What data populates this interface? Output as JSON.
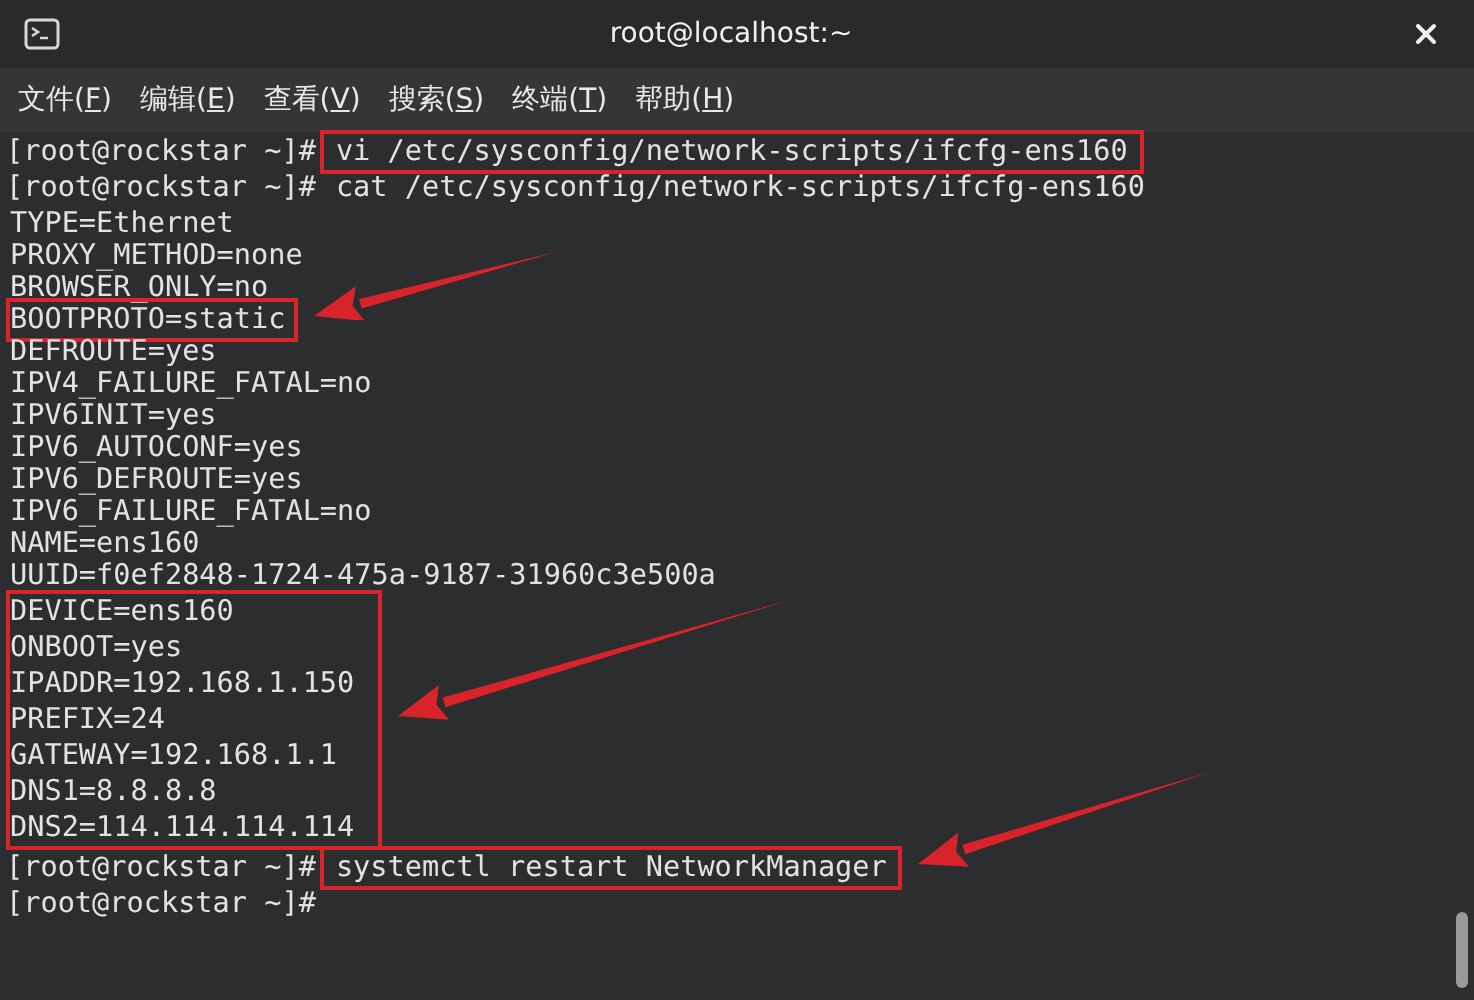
{
  "window": {
    "title": "root@localhost:~"
  },
  "menu": [
    {
      "label": "文件(F)"
    },
    {
      "label": "编辑(E)"
    },
    {
      "label": "查看(V)"
    },
    {
      "label": "搜索(S)"
    },
    {
      "label": "终端(T)"
    },
    {
      "label": "帮助(H)"
    }
  ],
  "terminal": {
    "items": [
      {
        "kind": "prompt",
        "prompt": "[root@rockstar ~]#",
        "command": "vi /etc/sysconfig/network-scripts/ifcfg-ens160",
        "highlighted": true,
        "arrow": false
      },
      {
        "kind": "prompt",
        "prompt": "[root@rockstar ~]#",
        "command": "cat /etc/sysconfig/network-scripts/ifcfg-ens160",
        "highlighted": false,
        "arrow": false
      },
      {
        "kind": "output",
        "text": "TYPE=Ethernet",
        "highlighted": false,
        "arrow": false
      },
      {
        "kind": "output",
        "text": "PROXY_METHOD=none",
        "highlighted": false,
        "arrow": false
      },
      {
        "kind": "output",
        "text": "BROWSER_ONLY=no",
        "highlighted": false,
        "arrow": false
      },
      {
        "kind": "output",
        "text": "BOOTPROTO=static",
        "highlighted": true,
        "arrow": true
      },
      {
        "kind": "output",
        "text": "DEFROUTE=yes",
        "highlighted": false,
        "arrow": false
      },
      {
        "kind": "output",
        "text": "IPV4_FAILURE_FATAL=no",
        "highlighted": false,
        "arrow": false
      },
      {
        "kind": "output",
        "text": "IPV6INIT=yes",
        "highlighted": false,
        "arrow": false
      },
      {
        "kind": "output",
        "text": "IPV6_AUTOCONF=yes",
        "highlighted": false,
        "arrow": false
      },
      {
        "kind": "output",
        "text": "IPV6_DEFROUTE=yes",
        "highlighted": false,
        "arrow": false
      },
      {
        "kind": "output",
        "text": "IPV6_FAILURE_FATAL=no",
        "highlighted": false,
        "arrow": false
      },
      {
        "kind": "output",
        "text": "NAME=ens160",
        "highlighted": false,
        "arrow": false
      },
      {
        "kind": "output",
        "text": "UUID=f0ef2848-1724-475a-9187-31960c3e500a",
        "highlighted": false,
        "arrow": false
      },
      {
        "kind": "group",
        "highlighted": true,
        "arrow": true,
        "lines": [
          "DEVICE=ens160",
          "ONBOOT=yes",
          "IPADDR=192.168.1.150",
          "PREFIX=24",
          "GATEWAY=192.168.1.1",
          "DNS1=8.8.8.8",
          "DNS2=114.114.114.114"
        ]
      },
      {
        "kind": "prompt",
        "prompt": "[root@rockstar ~]#",
        "command": "systemctl restart NetworkManager",
        "highlighted": true,
        "arrow": true
      },
      {
        "kind": "prompt",
        "prompt": "[root@rockstar ~]#"
      }
    ]
  }
}
